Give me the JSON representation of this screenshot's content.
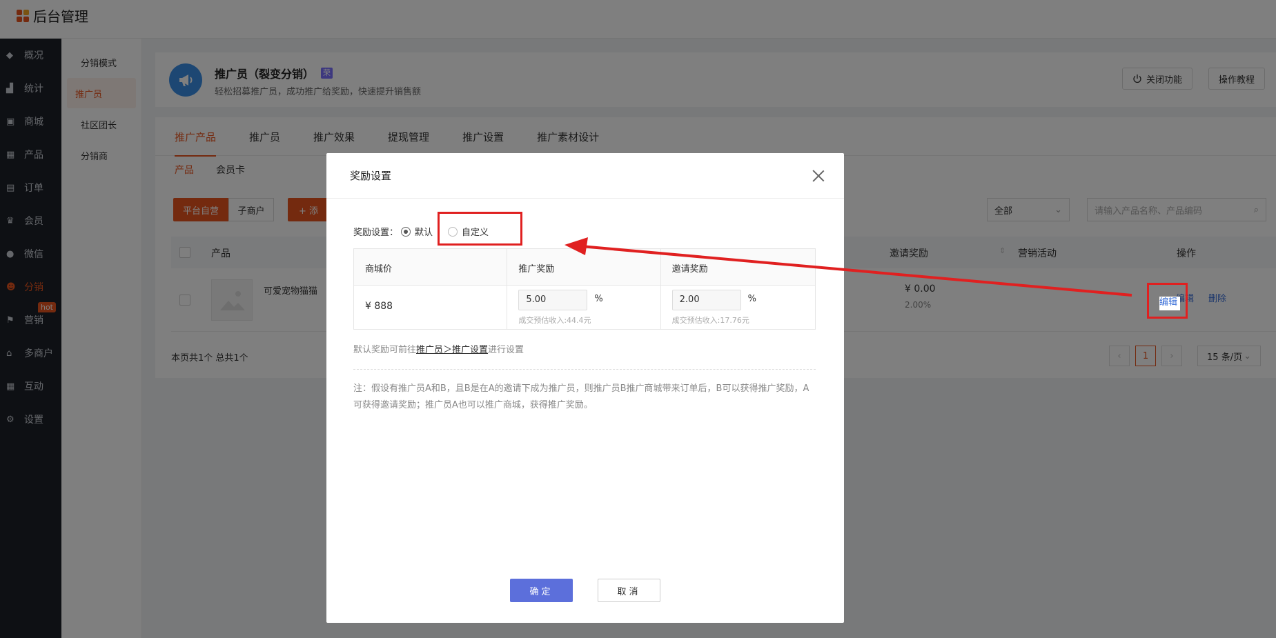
{
  "app": {
    "title": "后台管理"
  },
  "leftnav": {
    "items": [
      {
        "label": "概况",
        "icon": "layers-icon"
      },
      {
        "label": "统计",
        "icon": "chart-icon"
      },
      {
        "label": "商城",
        "icon": "store-icon"
      },
      {
        "label": "产品",
        "icon": "grid-icon"
      },
      {
        "label": "订单",
        "icon": "order-icon"
      },
      {
        "label": "会员",
        "icon": "crown-icon"
      },
      {
        "label": "微信",
        "icon": "wechat-icon"
      },
      {
        "label": "分销",
        "icon": "users-icon",
        "active": true
      },
      {
        "label": "营销",
        "icon": "flag-icon",
        "badge": "hot"
      },
      {
        "label": "多商户",
        "icon": "shop-icon"
      },
      {
        "label": "互动",
        "icon": "apps-icon"
      },
      {
        "label": "设置",
        "icon": "gear-icon"
      }
    ]
  },
  "subnav": {
    "items": [
      {
        "label": "分销模式"
      },
      {
        "label": "推广员",
        "active": true
      },
      {
        "label": "社区团长"
      },
      {
        "label": "分销商"
      }
    ]
  },
  "header": {
    "title": "推广员（裂变分销）",
    "badge": "荣",
    "desc": "轻松招募推广员，成功推广给奖励，快速提升销售额",
    "close_feature": "关闭功能",
    "tutorial": "操作教程"
  },
  "tabs": [
    "推广产品",
    "推广员",
    "推广效果",
    "提现管理",
    "推广设置",
    "推广素材设计"
  ],
  "subtabs": [
    "产品",
    "会员卡"
  ],
  "toolbar": {
    "self_operated": "平台自营",
    "sub_merchant": "子商户",
    "add": "+ 添",
    "filter_value": "全部",
    "search_placeholder": "请输入产品名称、产品编码"
  },
  "table": {
    "headers": {
      "product": "产品",
      "invite_reward": "邀请奖励",
      "activity": "营销活动",
      "ops": "操作"
    },
    "row": {
      "name": "可爱宠物猫猫",
      "invite_amount": "¥ 0.00",
      "invite_pct": "2.00%",
      "edit": "编辑",
      "delete": "删除"
    },
    "footer": "本页共1个 总共1个",
    "page": "1",
    "page_size": "15 条/页"
  },
  "modal": {
    "title": "奖励设置",
    "label": "奖励设置：",
    "option_default": "默认",
    "option_custom": "自定义",
    "columns": [
      "商城价",
      "推广奖励",
      "邀请奖励"
    ],
    "price": "¥ 888",
    "promo_reward": "5.00",
    "promo_est": "成交预估收入:44.4元",
    "invite_reward": "2.00",
    "invite_est": "成交预估收入:17.76元",
    "pct": "%",
    "hint_prefix": "默认奖励可前往",
    "hint_link": "推广员＞推广设置",
    "hint_suffix": "进行设置",
    "note": "注：假设有推广员A和B，且B是在A的邀请下成为推广员，则推广员B推广商城带来订单后，B可以获得推广奖励，A可获得邀请奖励；推广员A也可以推广商城，获得推广奖励。",
    "ok": "确定",
    "cancel": "取消"
  },
  "colors": {
    "accent": "#e8541e",
    "primary": "#5c6fdb",
    "annotation": "#e02020"
  }
}
